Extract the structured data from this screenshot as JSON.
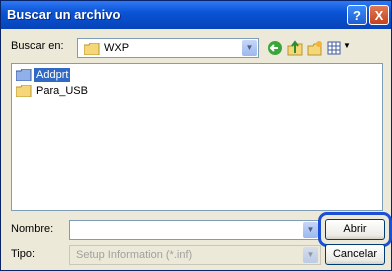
{
  "window": {
    "title": "Buscar un archivo",
    "help_icon": "?",
    "close_icon": "X"
  },
  "lookin": {
    "label": "Buscar en:",
    "value": "WXP"
  },
  "toolbar": {
    "icons": [
      "back-icon",
      "up-folder-icon",
      "new-folder-icon",
      "view-menu-icon"
    ]
  },
  "files": [
    {
      "name": "Addprt",
      "selected": true
    },
    {
      "name": "Para_USB",
      "selected": false
    }
  ],
  "filename": {
    "label": "Nombre:",
    "value": "",
    "button": "Abrir"
  },
  "filetype": {
    "label": "Tipo:",
    "value": "Setup Information (*.inf)",
    "button": "Cancelar"
  },
  "colors": {
    "title_bar": "#0a54d6",
    "highlight": "#1a4fd6",
    "selection": "#316ac5"
  }
}
